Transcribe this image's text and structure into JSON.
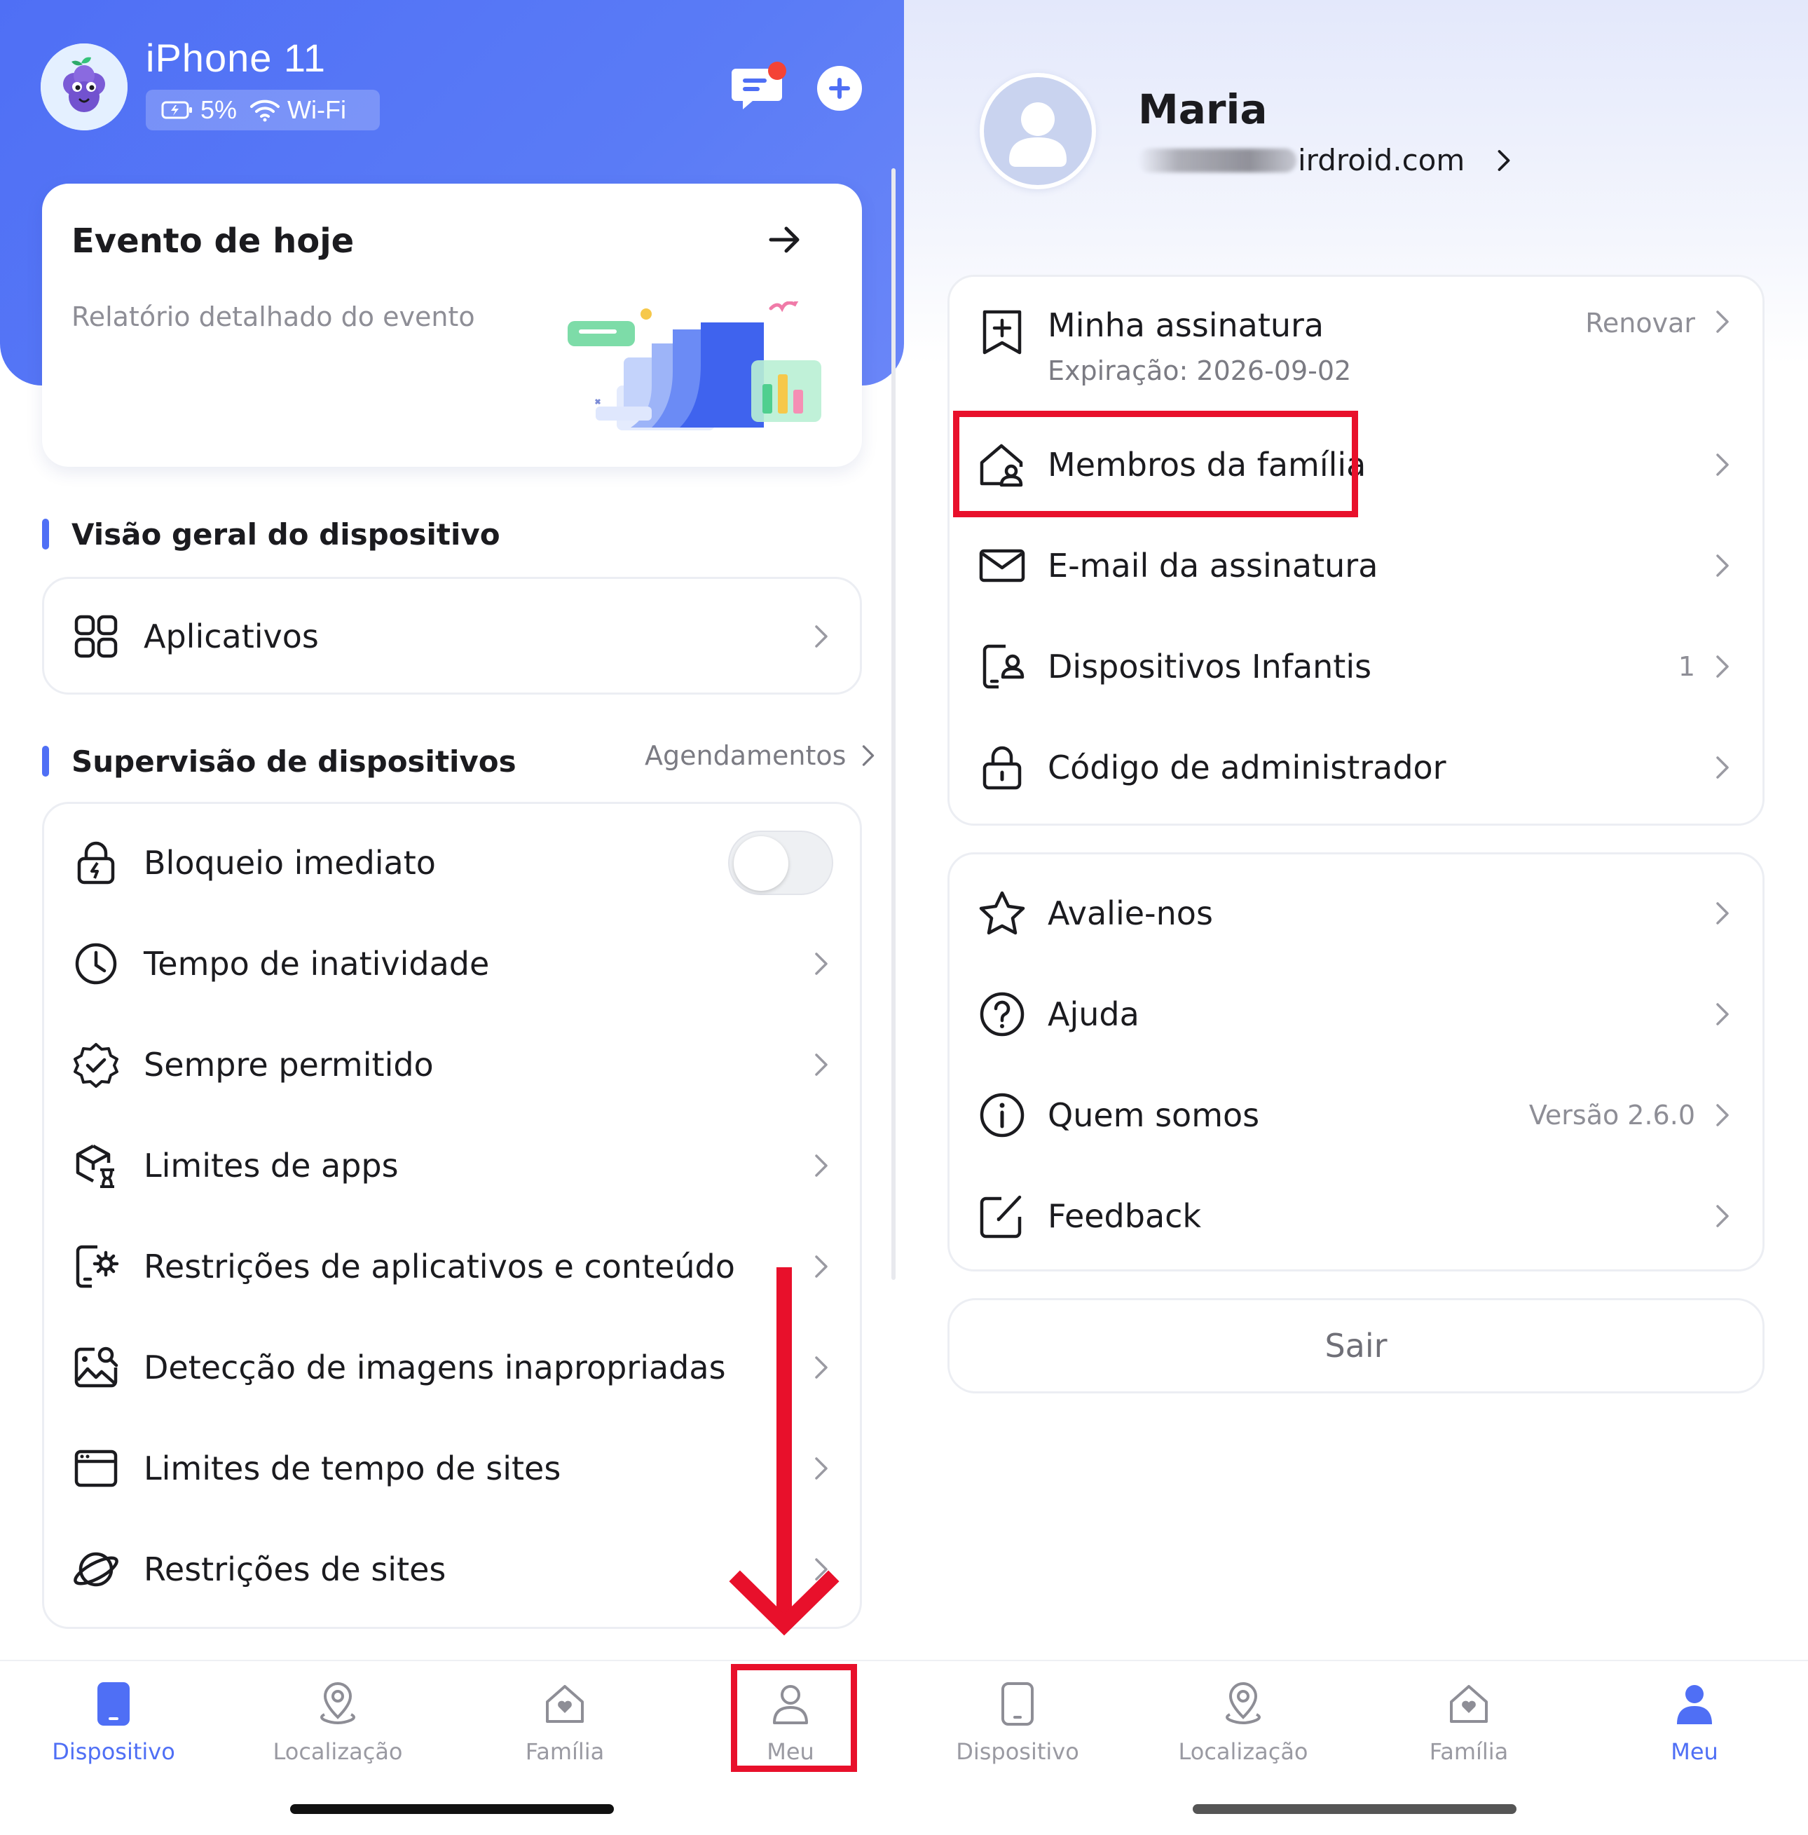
{
  "left": {
    "device": {
      "name": "iPhone 11",
      "battery": "5%",
      "network": "Wi-Fi"
    },
    "event": {
      "title": "Evento de hoje",
      "subtitle": "Relatório detalhado do evento"
    },
    "overview": {
      "title": "Visão geral do dispositivo",
      "apps_label": "Aplicativos"
    },
    "supervision": {
      "title": "Supervisão de dispositivos",
      "schedules_link": "Agendamentos",
      "items": [
        {
          "label": "Bloqueio imediato",
          "icon": "lock-icon"
        },
        {
          "label": "Tempo de inatividade",
          "icon": "clock-icon"
        },
        {
          "label": "Sempre permitido",
          "icon": "badge-check-icon"
        },
        {
          "label": "Limites de apps",
          "icon": "app-hourglass-icon"
        },
        {
          "label": "Restrições de aplicativos e conteúdo",
          "icon": "device-gear-icon"
        },
        {
          "label": "Detecção de imagens inapropriadas",
          "icon": "image-search-icon"
        },
        {
          "label": "Limites de tempo de sites",
          "icon": "browser-window-icon"
        },
        {
          "label": "Restrições de sites",
          "icon": "planet-icon"
        }
      ],
      "instant_lock_on": false
    },
    "tabs": [
      {
        "label": "Dispositivo",
        "icon": "phone-icon",
        "active": true
      },
      {
        "label": "Localização",
        "icon": "location-pin-icon",
        "active": false
      },
      {
        "label": "Família",
        "icon": "house-heart-icon",
        "active": false
      },
      {
        "label": "Meu",
        "icon": "person-icon",
        "active": false
      }
    ]
  },
  "right": {
    "profile": {
      "name": "Maria",
      "email_visible": "irdroid.com"
    },
    "account": [
      {
        "label": "Minha assinatura",
        "sub": "Expiração: 2026-09-02",
        "value": "Renovar",
        "icon": "bookmark-plus-icon"
      },
      {
        "label": "Membros da família",
        "icon": "house-person-icon"
      },
      {
        "label": "E-mail da assinatura",
        "icon": "mail-icon"
      },
      {
        "label": "Dispositivos Infantis",
        "value": "1",
        "icon": "child-device-icon"
      },
      {
        "label": "Código de administrador",
        "icon": "padlock-icon"
      }
    ],
    "misc": [
      {
        "label": "Avalie-nos",
        "icon": "star-icon"
      },
      {
        "label": "Ajuda",
        "icon": "question-icon"
      },
      {
        "label": "Quem somos",
        "value": "Versão 2.6.0",
        "icon": "info-icon"
      },
      {
        "label": "Feedback",
        "icon": "edit-icon"
      }
    ],
    "logout": "Sair",
    "tabs": [
      {
        "label": "Dispositivo",
        "icon": "phone-icon",
        "active": false
      },
      {
        "label": "Localização",
        "icon": "location-pin-icon",
        "active": false
      },
      {
        "label": "Família",
        "icon": "house-heart-icon",
        "active": false
      },
      {
        "label": "Meu",
        "icon": "person-icon",
        "active": true
      }
    ]
  },
  "colors": {
    "accent": "#4f6ff5",
    "highlight": "#e8102b",
    "inactive": "#9a9aa2"
  }
}
